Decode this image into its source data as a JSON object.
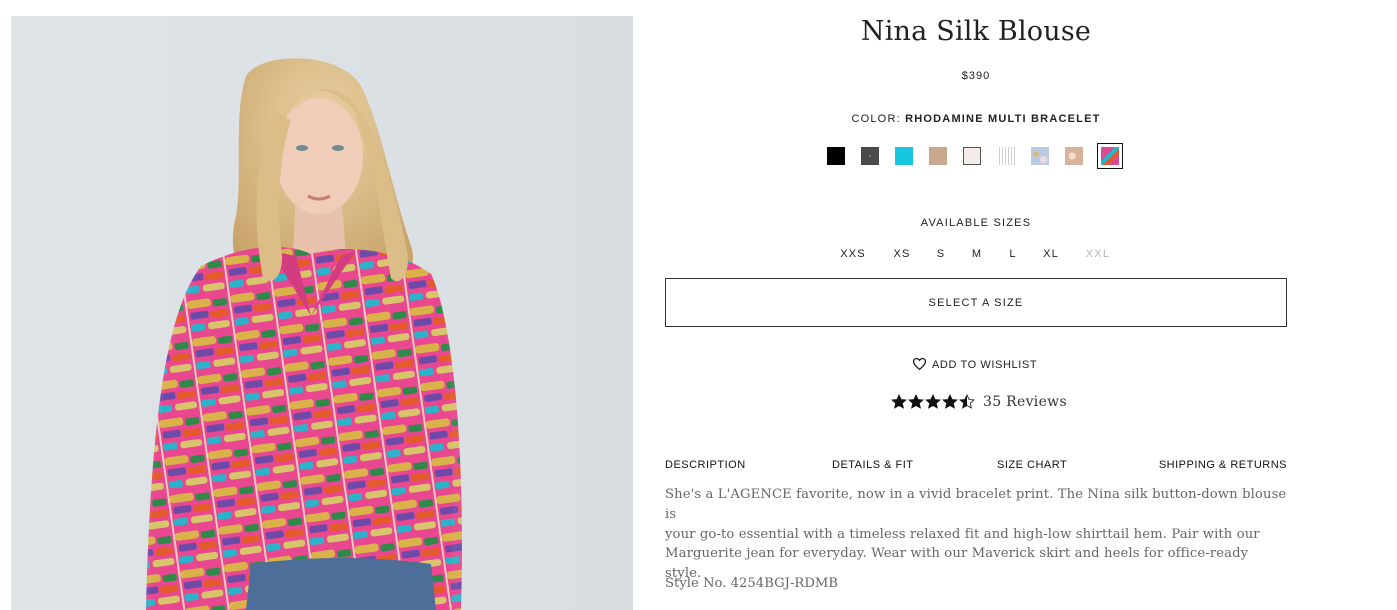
{
  "product": {
    "title": "Nina Silk Blouse",
    "price": "$390",
    "color_label": "COLOR:",
    "color_value": "RHODAMINE MULTI BRACELET",
    "swatches": [
      {
        "name": "black",
        "color": "#000000"
      },
      {
        "name": "black-print",
        "color": "#4a4a4a"
      },
      {
        "name": "turquoise",
        "color": "#19c6e0"
      },
      {
        "name": "tan",
        "color": "#c9a98e"
      },
      {
        "name": "ivory",
        "color": "#f3ecea"
      },
      {
        "name": "white-stripe",
        "color": "#e2e2e2"
      },
      {
        "name": "blue-floral",
        "color": "#b9cbe0"
      },
      {
        "name": "beige-print",
        "color": "#d8b39c"
      },
      {
        "name": "rhodamine-multi-bracelet",
        "color": "#d94b93",
        "selected": true
      }
    ],
    "sizes_label": "AVAILABLE SIZES",
    "sizes": [
      {
        "label": "XXS",
        "available": true
      },
      {
        "label": "XS",
        "available": true
      },
      {
        "label": "S",
        "available": true
      },
      {
        "label": "M",
        "available": true
      },
      {
        "label": "L",
        "available": true
      },
      {
        "label": "XL",
        "available": true
      },
      {
        "label": "XXL",
        "available": false
      }
    ],
    "select_size_label": "SELECT A SIZE",
    "wishlist_label": "ADD TO WISHLIST",
    "rating": 4.5,
    "reviews_label": "35 Reviews",
    "tabs": [
      "DESCRIPTION",
      "DETAILS & FIT",
      "SIZE CHART",
      "SHIPPING & RETURNS"
    ],
    "description_lines": [
      "She's a L'AGENCE favorite, now in a vivid bracelet print. The Nina silk button-down blouse is",
      "your go-to essential with a timeless relaxed fit and high-low shirttail hem. Pair with our",
      "Marguerite jean for everyday. Wear with our Maverick skirt and heels for office-ready style."
    ],
    "style_no": "Style No. 4254BGJ-RDMB"
  },
  "colors": {
    "accent": "#111111",
    "text_muted": "#666666",
    "disabled": "#b5b5b5",
    "blouse_pink": "#e9478f"
  }
}
